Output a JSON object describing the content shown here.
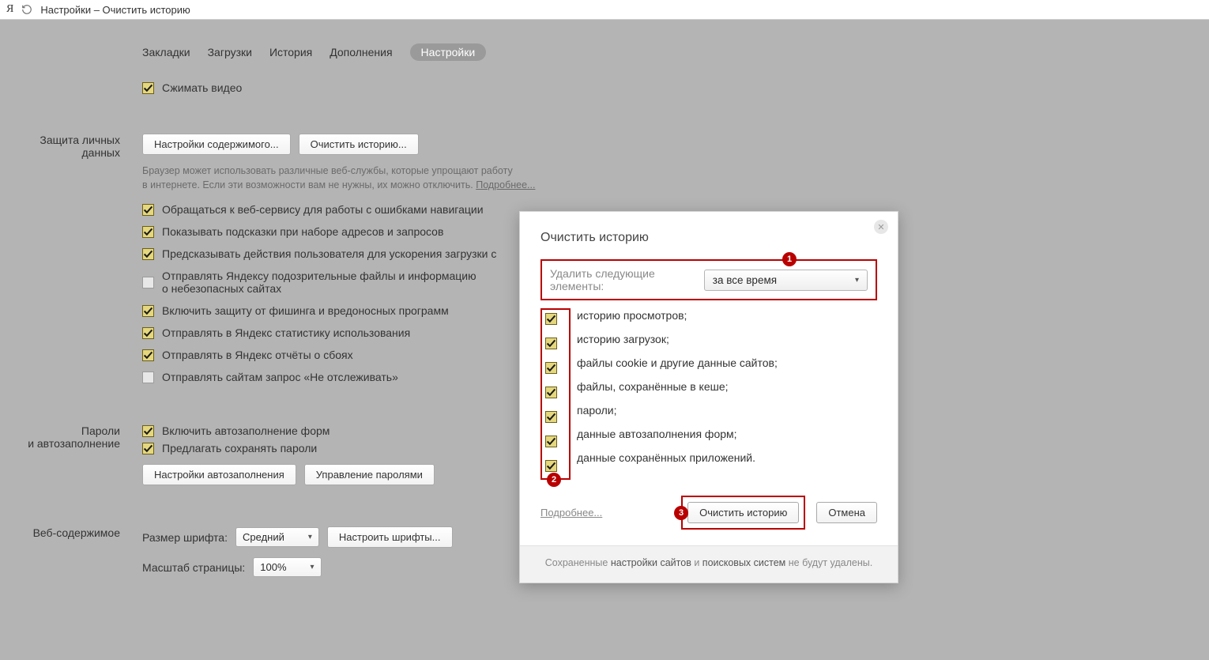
{
  "addr": {
    "logo": "Я",
    "title": "Настройки – Очистить историю"
  },
  "tabs": {
    "items": [
      "Закладки",
      "Загрузки",
      "История",
      "Дополнения",
      "Настройки"
    ],
    "active_index": 4
  },
  "top_option": {
    "label": "Сжимать видео",
    "checked": true
  },
  "privacy": {
    "title_line1": "Защита личных",
    "title_line2": "данных",
    "btn_content": "Настройки содержимого...",
    "btn_clear": "Очистить историю...",
    "desc_line1": "Браузер может использовать различные веб-службы, которые упрощают работу",
    "desc_line2": "в интернете. Если эти возможности вам не нужны, их можно отключить. ",
    "desc_link": "Подробнее...",
    "options": [
      {
        "label": "Обращаться к веб-сервису для работы с ошибками навигации",
        "checked": true
      },
      {
        "label": "Показывать подсказки при наборе адресов и запросов",
        "checked": true
      },
      {
        "label": "Предсказывать действия пользователя для ускорения загрузки с",
        "checked": true
      },
      {
        "label": "Отправлять Яндексу подозрительные файлы и информацию\nо небезопасных сайтах",
        "checked": false
      },
      {
        "label": "Включить защиту от фишинга и вредоносных программ",
        "checked": true
      },
      {
        "label": "Отправлять в Яндекс статистику использования",
        "checked": true
      },
      {
        "label": "Отправлять в Яндекс отчёты о сбоях",
        "checked": true
      },
      {
        "label": "Отправлять сайтам запрос «Не отслеживать»",
        "checked": false
      }
    ]
  },
  "passwords": {
    "title_line1": "Пароли",
    "title_line2": "и автозаполнение",
    "opt_autofill": {
      "label": "Включить автозаполнение форм",
      "checked": true
    },
    "opt_save_pw": {
      "label": "Предлагать сохранять пароли",
      "checked": true
    },
    "btn_autofill": "Настройки автозаполнения",
    "btn_manage_pw": "Управление паролями"
  },
  "web_content": {
    "title": "Веб-содержимое",
    "font_size_label": "Размер шрифта:",
    "font_size_value": "Средний",
    "btn_fonts": "Настроить шрифты...",
    "zoom_label": "Масштаб страницы:",
    "zoom_value": "100%"
  },
  "dialog": {
    "title": "Очистить историю",
    "delete_label": "Удалить следующие элементы:",
    "period_value": "за все время",
    "options": [
      "историю просмотров;",
      "историю загрузок;",
      "файлы cookie и другие данные сайтов;",
      "файлы, сохранённые в кеше;",
      "пароли;",
      "данные автозаполнения форм;",
      "данные сохранённых приложений."
    ],
    "link_more": "Подробнее...",
    "btn_clear": "Очистить историю",
    "btn_cancel": "Отмена",
    "note_prefix": "Сохраненные ",
    "note_b1": "настройки сайтов",
    "note_mid": " и ",
    "note_b2": "поисковых систем",
    "note_suffix": " не будут удалены.",
    "markers": {
      "m1": "1",
      "m2": "2",
      "m3": "3"
    }
  }
}
